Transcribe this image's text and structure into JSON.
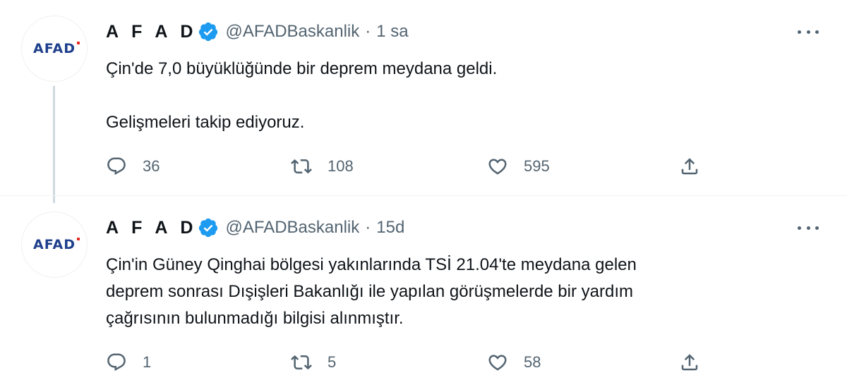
{
  "colors": {
    "text": "#0f1419",
    "muted": "#536471",
    "verified": "#1d9bf0",
    "logo_blue": "#1e3f8c",
    "logo_red": "#e2231a"
  },
  "tweets": [
    {
      "avatar_logo": "AFAD",
      "name": "A F A D",
      "handle": "@AFADBaskanlik",
      "separator": "·",
      "time": "1 sa",
      "lines": [
        "Çin'de 7,0 büyüklüğünde bir deprem meydana geldi.",
        "Gelişmeleri takip ediyoruz."
      ],
      "replies": "36",
      "retweets": "108",
      "likes": "595"
    },
    {
      "avatar_logo": "AFAD",
      "name": "A F A D",
      "handle": "@AFADBaskanlik",
      "separator": "·",
      "time": "15d",
      "lines": [
        "Çin'in Güney Qinghai bölgesi yakınlarında TSİ 21.04'te meydana gelen",
        "deprem sonrası Dışişleri Bakanlığı ile yapılan görüşmelerde bir yardım",
        "çağrısının bulunmadığı bilgisi alınmıştır."
      ],
      "replies": "1",
      "retweets": "5",
      "likes": "58"
    }
  ],
  "icons": [
    "verified-badge-icon",
    "more-icon",
    "reply-icon",
    "retweet-icon",
    "like-icon",
    "share-icon"
  ]
}
